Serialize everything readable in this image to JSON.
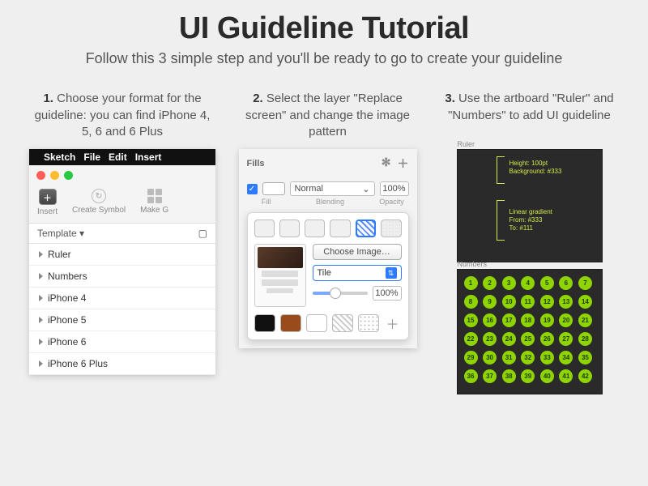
{
  "hero": {
    "title": "UI Guideline Tutorial",
    "subtitle": "Follow this 3 simple step and you'll be ready to go to create your guideline"
  },
  "steps": {
    "s1_num": "1.",
    "s1_text": " Choose your format for the guideline: you can find iPhone 4, 5, 6 and 6 Plus",
    "s2_num": "2.",
    "s2_text": " Select the layer \"Replace screen\" and change the image pattern",
    "s3_num": "3.",
    "s3_text": " Use the artboard \"Ruler\" and \"Numbers\" to add UI guideline"
  },
  "panel1": {
    "menu": {
      "apple": "",
      "app": "Sketch",
      "file": "File",
      "edit": "Edit",
      "insert": "Insert"
    },
    "toolbar": {
      "insert": "Insert",
      "create_symbol": "Create Symbol",
      "make_grid": "Make G"
    },
    "template_label": "Template ▾",
    "items": [
      "Ruler",
      "Numbers",
      "iPhone 4",
      "iPhone 5",
      "iPhone 6",
      "iPhone 6 Plus"
    ]
  },
  "panel2": {
    "title": "Fills",
    "blend_mode": "Normal",
    "opacity": "100%",
    "labels": {
      "fill": "Fill",
      "blending": "Blending",
      "opacity": "Opacity"
    },
    "choose_image": "Choose Image…",
    "tile_mode": "Tile",
    "scale": "100%"
  },
  "panel3": {
    "ruler_label": "Ruler",
    "spec1_l1": "Height: 100pt",
    "spec1_l2": "Background: #333",
    "spec2_l1": "Linear gradient",
    "spec2_l2": "From: #333",
    "spec2_l3": "To: #111",
    "numbers_label": "Numbers"
  }
}
